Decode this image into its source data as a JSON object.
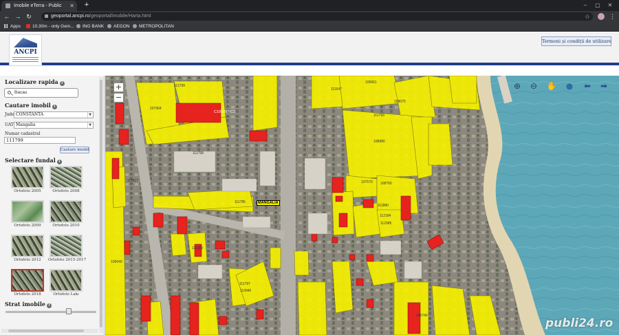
{
  "browser": {
    "tab_title": "Imobile eTerra - Public",
    "url_host": "geoportal.ancpi.ro",
    "url_path": "/geoportal/imobile/Harta.html",
    "bookmarks": [
      "Apps",
      "10.30m - only Gem...",
      "ING BANK",
      "AEGON",
      "METROPOLITAN"
    ]
  },
  "header": {
    "logo_text": "ANCPI",
    "terms_button": "Termeni și condiții de utilizare"
  },
  "sidebar": {
    "localizare_title": "Localizare rapida",
    "search_value": "Bacau",
    "cautare_title": "Cautare imobil",
    "judet_label": "Judet",
    "judet_value": "CONSTANTA",
    "uat_label": "UAT",
    "uat_value": "Mangalia",
    "numar_label": "Numar cadastral",
    "numar_value": "111799",
    "cauta_button": "Cautare imobil",
    "fundal_title": "Selectare fundal",
    "backgrounds": [
      {
        "label": "Ortofoto 2005"
      },
      {
        "label": "Ortofoto 2008"
      },
      {
        "label": "Ortofoto 2009"
      },
      {
        "label": "Ortofoto 2010"
      },
      {
        "label": "Ortofoto 2012"
      },
      {
        "label": "Ortofoto 2015-2017"
      },
      {
        "label": "Ortofoto 2018"
      },
      {
        "label": "Ortofoto Lakı"
      }
    ],
    "strat_title": "Strat imobile"
  },
  "map": {
    "zoom_in": "+",
    "zoom_out": "−",
    "selected_parcel": "C10579?-C1",
    "street_name": "MANGALIA",
    "watermark": "publi24.ro",
    "parcel_labels": [
      "111799",
      "107964",
      "111647",
      "109061",
      "108075",
      "108980",
      "111793",
      "111758",
      "111785",
      "107570",
      "108760",
      "111880",
      "112184",
      "112985",
      "111380",
      "109040",
      "110940",
      "111797",
      "105740",
      "111817"
    ]
  },
  "colors": {
    "parcel_fill": "#f5f000",
    "building_fill": "#e6231e",
    "sea": "#5da8b8",
    "brand_blue": "#1f3f8a"
  }
}
